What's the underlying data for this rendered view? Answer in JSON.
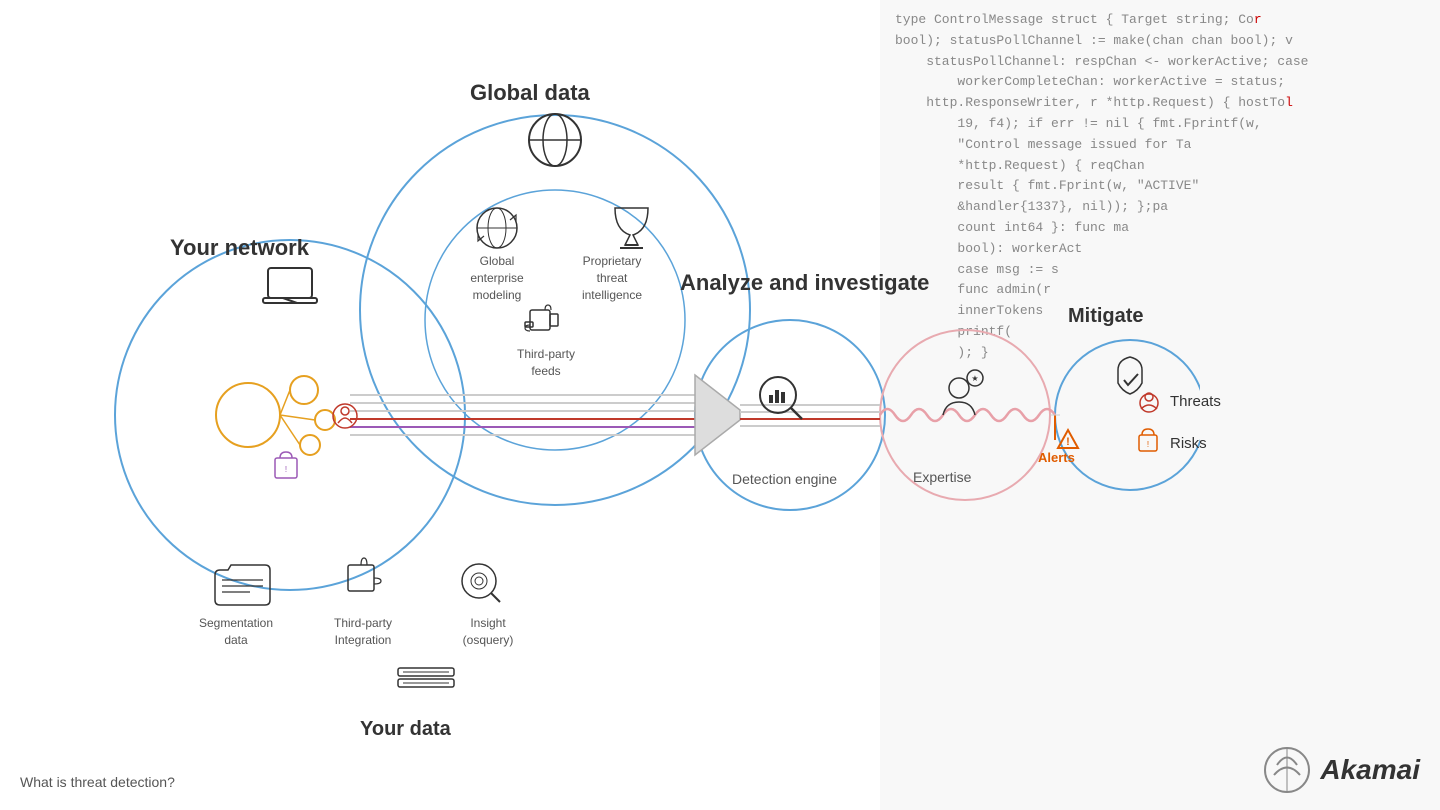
{
  "code_lines": [
    "type ControlMessage struct { Target string; Cor",
    "bool); statusPollChannel := make(chan chan bool); v",
    "statusPollChannel: respChan <- workerActive; case",
    "    workerCompleteChan: workerActive = status;",
    "    http.ResponseWriter, r *http.Request) { hostTo",
    "    19, f4); if err != nil { fmt.Fprintf(w,",
    "    \"Control message issued for Ta",
    "    *http.Request) { reqChan",
    "    result { fmt.Fprint(w, \"ACTIVE\"",
    "    &handler{1337}, nil)); };pa",
    "    count int64 }: func ma",
    "    bool): workerAct",
    "    case msg := s",
    "    func admin(r",
    "    innerTokens",
    "    printf(",
    "    ); }"
  ],
  "sections": {
    "your_network": {
      "title": "Your network",
      "items": [
        {
          "label": "Segmentation\ndata"
        },
        {
          "label": "Third-party\nIntegration"
        },
        {
          "label": "Insight\n(osquery)"
        }
      ],
      "your_data": "Your data"
    },
    "global_data": {
      "title": "Global data",
      "items": [
        {
          "label": "Global\nenterprise\nmodeling"
        },
        {
          "label": "Proprietary\nthreat\nintelligence"
        },
        {
          "label": "Third-party\nfeeds"
        }
      ]
    },
    "analyze": {
      "title": "Analyze and investigate",
      "detection_engine": "Detection engine",
      "expertise": "Expertise"
    },
    "mitigate": {
      "title": "Mitigate",
      "alerts": "Alerts",
      "threats": "Threats",
      "risks": "Risks"
    }
  },
  "bottom": {
    "question": "What is threat detection?"
  },
  "logo": {
    "text": "Akamai"
  }
}
